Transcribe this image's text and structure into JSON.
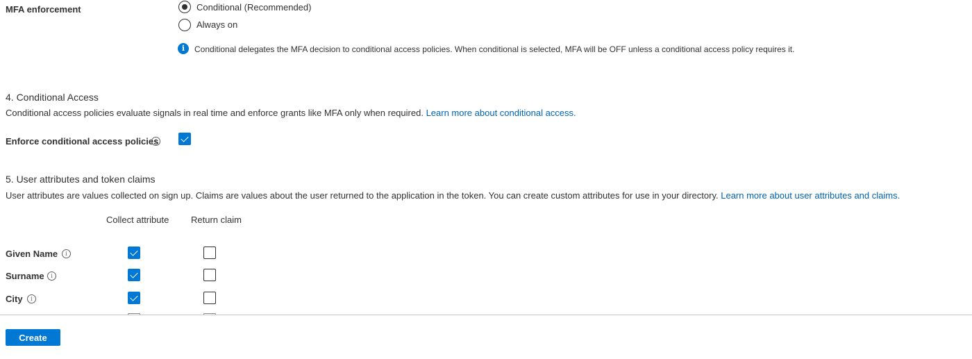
{
  "mfa": {
    "label": "MFA enforcement",
    "options": [
      {
        "label": "Conditional (Recommended)",
        "selected": true
      },
      {
        "label": "Always on",
        "selected": false
      }
    ],
    "info_text": "Conditional delegates the MFA decision to conditional access policies. When conditional is selected, MFA will be OFF unless a conditional access policy requires it."
  },
  "conditional_access": {
    "title": "4. Conditional Access",
    "description": "Conditional access policies evaluate signals in real time and enforce grants like MFA only when required.",
    "link": "Learn more about conditional access.",
    "enforce_label": "Enforce conditional access policies",
    "enforce_checked": true
  },
  "user_attributes": {
    "title": "5. User attributes and token claims",
    "description": "User attributes are values collected on sign up. Claims are values about the user returned to the application in the token. You can create custom attributes for use in your directory.",
    "link": "Learn more about user attributes and claims.",
    "columns": [
      "Collect attribute",
      "Return claim"
    ],
    "rows": [
      {
        "name": "Given Name",
        "collect": true,
        "return": false
      },
      {
        "name": "Surname",
        "collect": true,
        "return": false
      },
      {
        "name": "City",
        "collect": true,
        "return": false
      }
    ]
  },
  "footer": {
    "create_label": "Create"
  },
  "icons": {
    "info_filled": "info-circle-filled-icon",
    "info_outline": "info-circle-outline-icon"
  },
  "colors": {
    "accent": "#0078d4",
    "link": "#0063b1"
  }
}
